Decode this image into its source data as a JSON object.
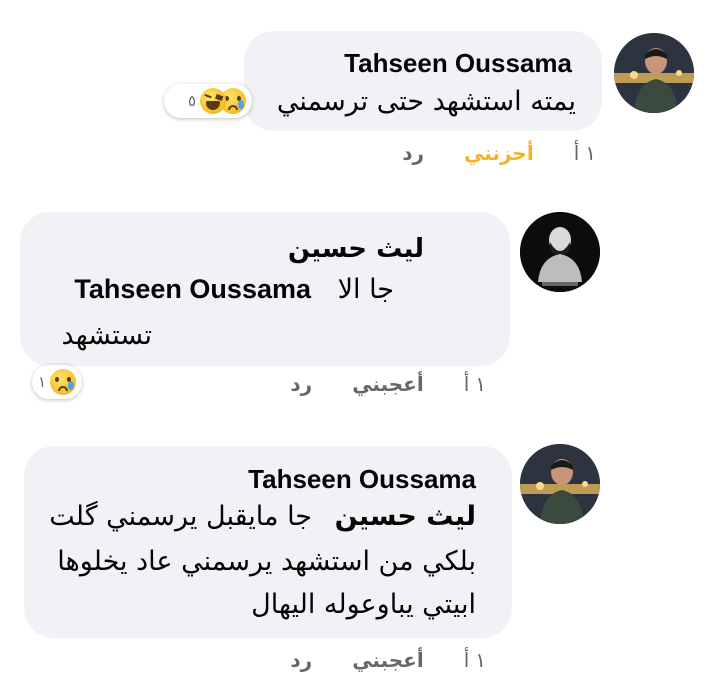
{
  "comments": [
    {
      "author": "Tahseen Oussama",
      "text_lines": [
        "يمته استشهد حتى ترسمني"
      ],
      "reactions": {
        "count": "٥",
        "icons": [
          "sad-emoji",
          "haha-emoji"
        ]
      },
      "actions": {
        "count": "١",
        "icon": "أ",
        "reaction": "أحزنني",
        "reaction_color": "#f7b125",
        "reply": "رد"
      }
    },
    {
      "author": "ليث حسين",
      "mention": "Tahseen Oussama",
      "text_after_mention": "جا الا",
      "text_lines": [
        "تستشهد"
      ],
      "reactions": {
        "count": "١",
        "icons": [
          "sad-emoji"
        ]
      },
      "actions": {
        "count": "١",
        "icon": "أ",
        "reaction": "أعجبني",
        "reply": "رد"
      }
    },
    {
      "author": "Tahseen Oussama",
      "mention": "ليث حسين",
      "text_after_mention": "جا مايقبل يرسمني گلت",
      "text_lines": [
        "بلكي من استشهد يرسمني عاد يخلوها",
        "ابيتي يباوعوله اليهال"
      ],
      "actions": {
        "count": "١",
        "icon": "أ",
        "reaction": "أعجبني",
        "reply": "رد"
      }
    }
  ]
}
